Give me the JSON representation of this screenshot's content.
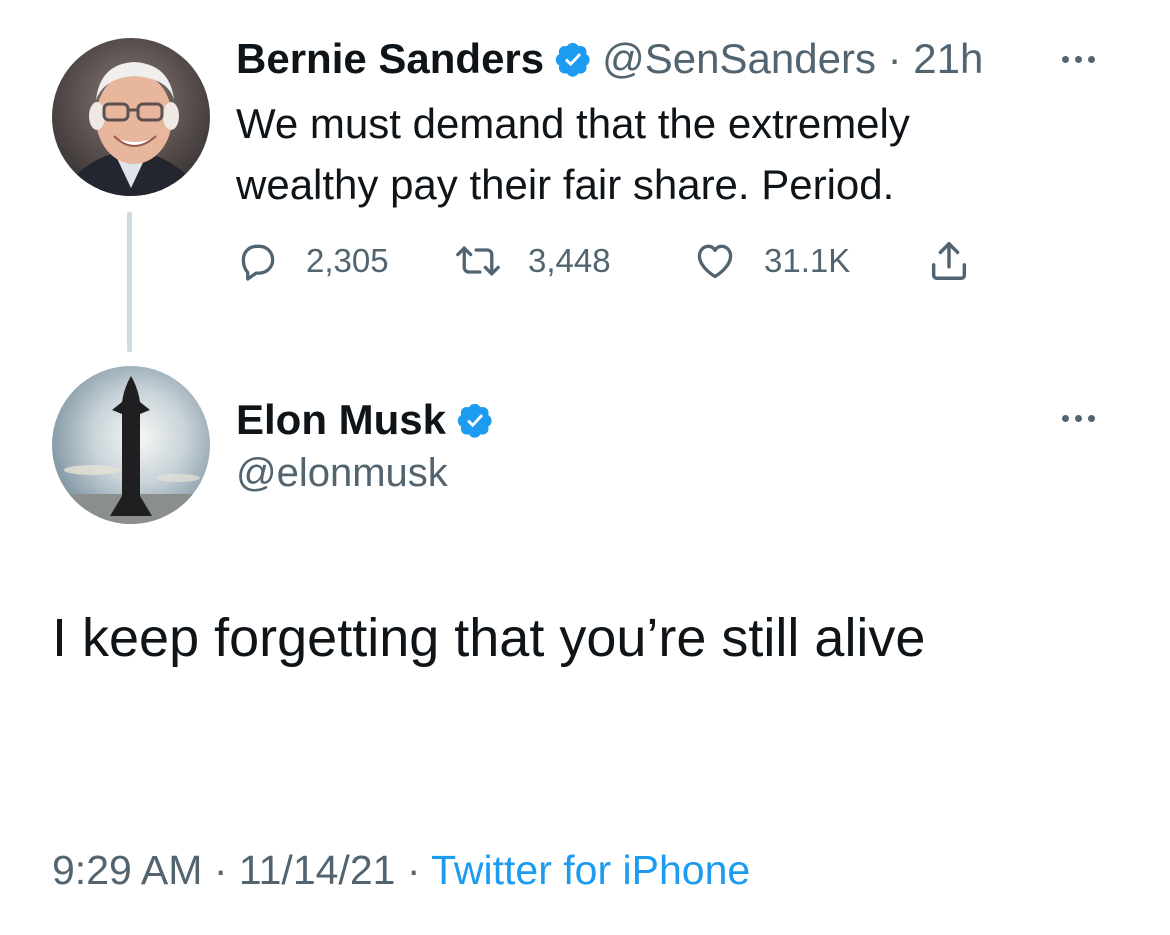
{
  "parent_tweet": {
    "author_name": "Bernie Sanders",
    "handle_meta": "@SenSanders · 21h",
    "text": "We must demand that the extremely wealthy pay their fair share. Period.",
    "reply_count": "2,305",
    "retweet_count": "3,448",
    "like_count": "31.1K",
    "verified_icon": "verified-badge-icon"
  },
  "reply_tweet": {
    "author_name": "Elon Musk",
    "handle": "@elonmusk",
    "text": "I keep forgetting that you’re still alive",
    "time": "9:29 AM",
    "date": "11/14/21",
    "source": "Twitter for iPhone",
    "separator": " · "
  },
  "colors": {
    "accent": "#1d9bf0",
    "secondary_text": "#536471",
    "primary_text": "#0f1419",
    "thread_line": "#cfd9de"
  }
}
